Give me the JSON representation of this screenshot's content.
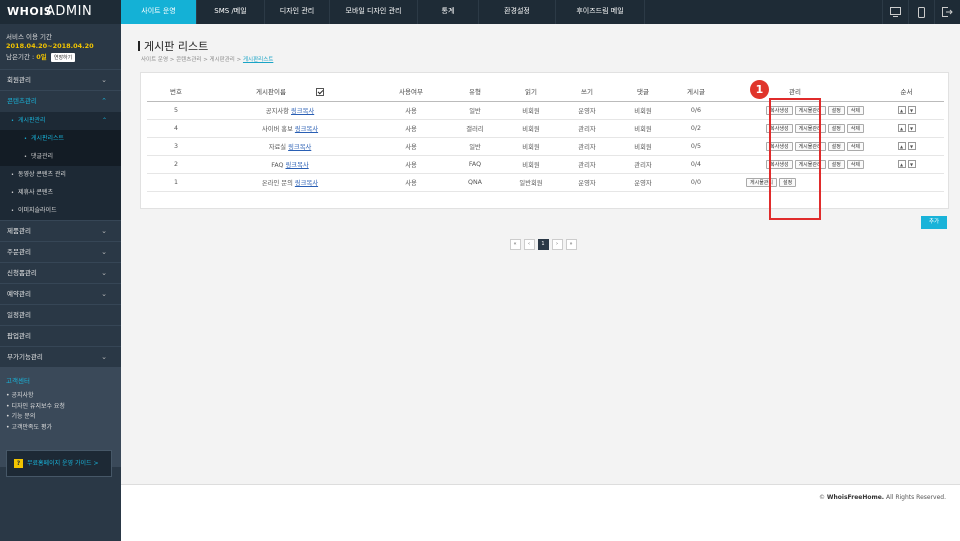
{
  "logo": {
    "brand": "WHOIS",
    "title": "ADMIN"
  },
  "topnav": [
    {
      "label": "사이트 운영",
      "active": true
    },
    {
      "label": "SMS /메일",
      "active": false
    },
    {
      "label": "디자인 관리",
      "active": false
    },
    {
      "label": "모바일 디자인 관리",
      "active": false
    },
    {
      "label": "통계",
      "active": false
    },
    {
      "label": "환경설정",
      "active": false
    },
    {
      "label": "후이즈드림 메일",
      "active": false
    }
  ],
  "topicons": [
    "monitor-icon",
    "mobile-icon",
    "logout-icon"
  ],
  "service": {
    "label": "서비스 이용 기간",
    "period": "2018.04.20~2018.04.20",
    "remain_label": "남은기간 :",
    "remain_value": "0일",
    "extend_label": "연장하기"
  },
  "sidebar": {
    "menu1": "회원관리",
    "menu2": "콘텐츠관리",
    "sub1": "게시판관리",
    "sub1_items": [
      "게시판리스트",
      "댓글관리"
    ],
    "sub2": "동영상 콘텐츠 관리",
    "sub3": "제휴사 콘텐츠",
    "sub4": "이미지슬라이드",
    "menu3": "제품관리",
    "menu4": "주문관리",
    "menu5": "신청폼관리",
    "menu6": "예약관리",
    "menu7": "일정관리",
    "menu8": "팝업관리",
    "menu9": "부가기능관리"
  },
  "cs": {
    "title": "고객센터",
    "items": [
      "공지사항",
      "디자인 유지보수 요청",
      "기능 문의",
      "고객만족도 평가"
    ]
  },
  "guide_label": "무료홈페이지 운영 가이드 >",
  "page": {
    "title": "게시판 리스트",
    "crumb": "사이트 운영 > 콘텐츠관리 > 게시판관리 > ",
    "crumb_current": "게시판리스트"
  },
  "table": {
    "headers": [
      "번호",
      "게시판이름",
      "사용여부",
      "유형",
      "읽기",
      "쓰기",
      "댓글",
      "게시글",
      "관리",
      "순서"
    ],
    "rows": [
      {
        "no": "5",
        "name": "공지사항",
        "link": "링크복사",
        "use": "사용",
        "type": "일반",
        "read": "비회원",
        "write": "운영자",
        "comment": "비회원",
        "posts": "0/6",
        "btns": [
          "복사생성",
          "게시물관리",
          "설정",
          "삭제"
        ]
      },
      {
        "no": "4",
        "name": "사이버 홍보",
        "link": "링크복사",
        "use": "사용",
        "type": "갤러리",
        "read": "비회원",
        "write": "관리자",
        "comment": "비회원",
        "posts": "0/2",
        "btns": [
          "복사생성",
          "게시물관리",
          "설정",
          "삭제"
        ]
      },
      {
        "no": "3",
        "name": "자료실",
        "link": "링크복사",
        "use": "사용",
        "type": "일반",
        "read": "비회원",
        "write": "관리자",
        "comment": "비회원",
        "posts": "0/5",
        "btns": [
          "복사생성",
          "게시물관리",
          "설정",
          "삭제"
        ]
      },
      {
        "no": "2",
        "name": "FAQ",
        "link": "링크복사",
        "use": "사용",
        "type": "FAQ",
        "read": "비회원",
        "write": "관리자",
        "comment": "관리자",
        "posts": "0/4",
        "btns": [
          "복사생성",
          "게시물관리",
          "설정",
          "삭제"
        ]
      },
      {
        "no": "1",
        "name": "온라인 문의",
        "link": "링크복사",
        "use": "사용",
        "type": "QNA",
        "read": "일반회원",
        "write": "운영자",
        "comment": "운영자",
        "posts": "0/0",
        "btns": [
          "게시물관리",
          "설정"
        ]
      }
    ],
    "order_up": "▲",
    "order_down": "▼"
  },
  "badge": "1",
  "add_label": "추가",
  "pager": [
    "«",
    "‹",
    "1",
    "›",
    "»"
  ],
  "footer": {
    "brand": "WhoisFreeHome.",
    "rights": " All Rights Reserved.",
    "copy_sign": "© "
  },
  "colors": {
    "accent": "#19b3d9",
    "sidebar": "#2a3846",
    "topbar": "#1e2b36",
    "highlight": "#e02b2b"
  }
}
